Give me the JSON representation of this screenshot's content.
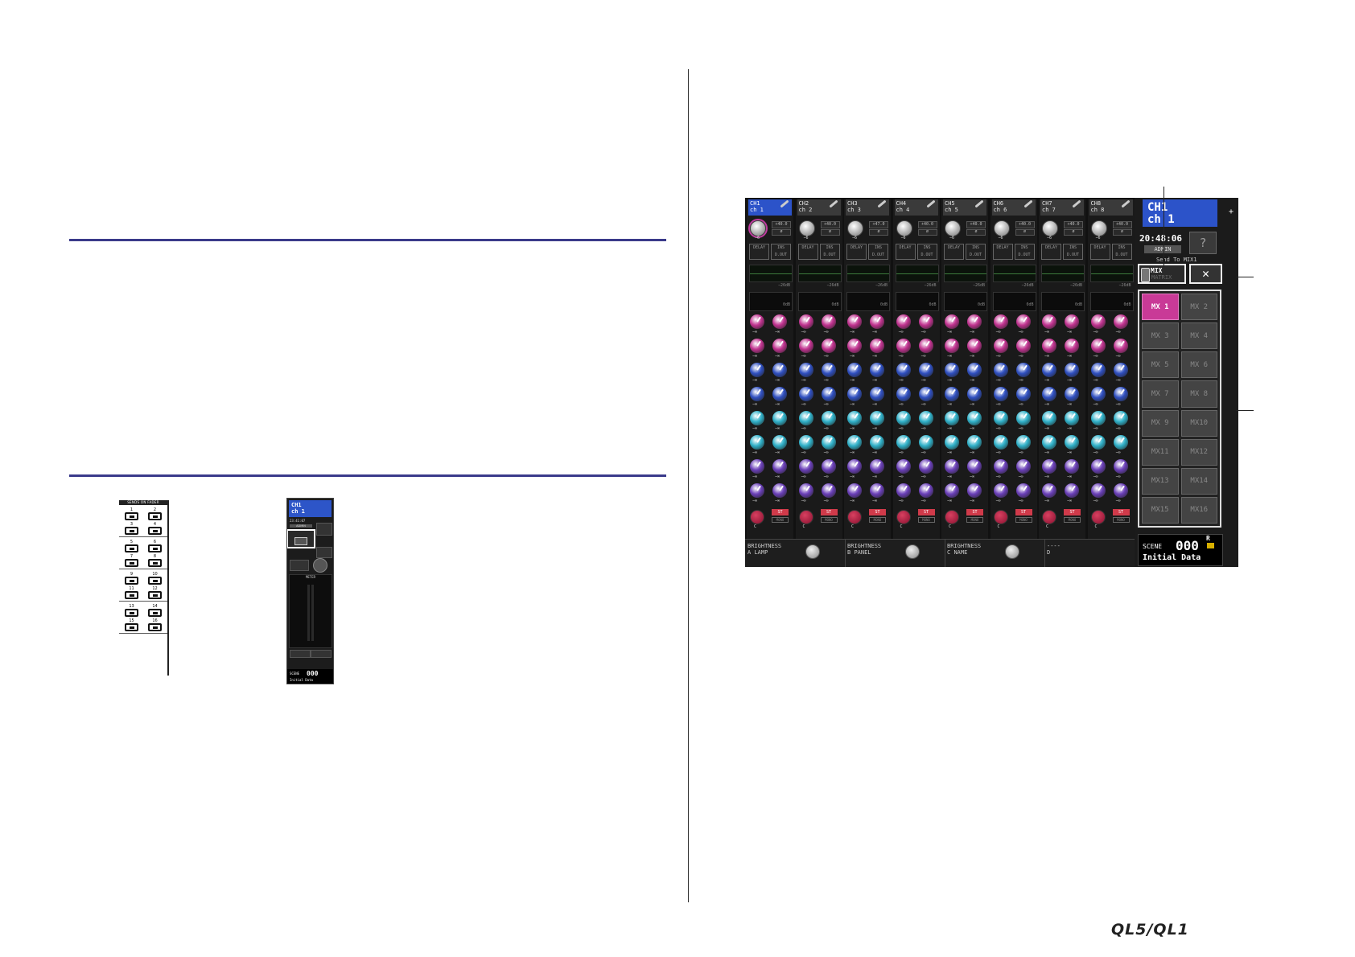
{
  "sends_panel": {
    "title": "SENDS ON FADER",
    "buttons": [
      "1",
      "2",
      "3",
      "4",
      "5",
      "6",
      "7",
      "8",
      "9",
      "10",
      "11",
      "12",
      "13",
      "14",
      "15",
      "16"
    ]
  },
  "small_strip": {
    "channel_id": "CH1",
    "channel_name": "ch 1",
    "time": "23:41:07",
    "user": "ADMIN",
    "meter_label": "METER",
    "scene_label": "SCENE",
    "scene_number": "000",
    "scene_title": "Initial Data"
  },
  "screen": {
    "channels": [
      {
        "id": "CH1",
        "name": "ch 1",
        "gain": "+40.0",
        "selected": true
      },
      {
        "id": "CH2",
        "name": "ch 2",
        "gain": "+40.0",
        "selected": false
      },
      {
        "id": "CH3",
        "name": "ch 3",
        "gain": "+47.0",
        "selected": false
      },
      {
        "id": "CH4",
        "name": "ch 4",
        "gain": "+40.0",
        "selected": false
      },
      {
        "id": "CH5",
        "name": "ch 5",
        "gain": "+40.0",
        "selected": false
      },
      {
        "id": "CH6",
        "name": "ch 6",
        "gain": "+40.0",
        "selected": false
      },
      {
        "id": "CH7",
        "name": "ch 7",
        "gain": "+40.0",
        "selected": false
      },
      {
        "id": "CH8",
        "name": "ch 8",
        "gain": "+40.0",
        "selected": false
      }
    ],
    "phase_symbol": "ø",
    "gain_value": "−6",
    "delay_label": "DELAY",
    "ins_label": "INS",
    "dout_label": "D.OUT",
    "dyn_thresh": "−26dB",
    "dyn_gain": "0dB",
    "send_level": "−∞",
    "pan_value": "C",
    "st_label": "ST",
    "mono_label": "MONO",
    "encoders": [
      {
        "letter": "A",
        "line1": "BRIGHTNESS",
        "line2": "LAMP"
      },
      {
        "letter": "B",
        "line1": "BRIGHTNESS",
        "line2": "PANEL"
      },
      {
        "letter": "C",
        "line1": "BRIGHTNESS",
        "line2": "NAME"
      },
      {
        "letter": "D",
        "line1": "----",
        "line2": ""
      }
    ],
    "side": {
      "channel_id": "CH1",
      "channel_name": "ch 1",
      "time": "20:48:06",
      "user": "ADMIN",
      "help": "?",
      "send_to": "Send To MIX1",
      "mix_label": "MIX",
      "matrix_label": "MATRIX",
      "close_symbol": "✕",
      "mix_buttons": [
        "MX 1",
        "MX 2",
        "MX 3",
        "MX 4",
        "MX 5",
        "MX 6",
        "MX 7",
        "MX 8",
        "MX 9",
        "MX10",
        "MX11",
        "MX12",
        "MX13",
        "MX14",
        "MX15",
        "MX16"
      ],
      "active_mix": "MX 1",
      "scene_label": "SCENE",
      "scene_number": "000",
      "scene_flag": "R",
      "scene_title": "Initial Data"
    }
  },
  "footer_logo": "QL5/QL1",
  "colors": {
    "rule": "#3a3a8a",
    "selected_channel": "#2c53c9",
    "active_mix": "#c93a97",
    "knob_magenta": "#c0328f",
    "knob_blue": "#2f4fc0",
    "knob_cyan": "#2fb0c8",
    "knob_purple": "#6a3fb8",
    "pan_red": "#d84060"
  }
}
